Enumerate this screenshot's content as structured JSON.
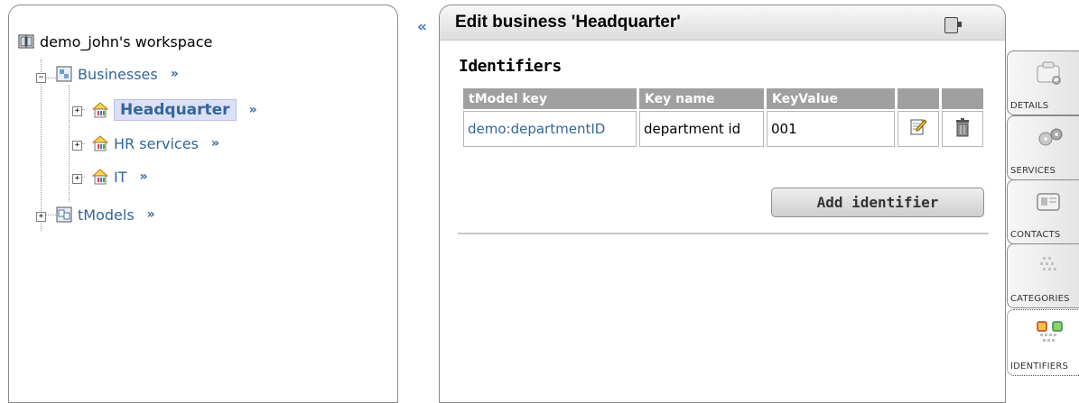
{
  "tree": {
    "workspace": "demo_john's workspace",
    "businesses": "Businesses",
    "children": [
      {
        "label": "Headquarter"
      },
      {
        "label": "HR services"
      },
      {
        "label": "IT"
      }
    ],
    "tmodels": "tModels",
    "chevron": "»"
  },
  "collapse_glyph": "«",
  "edit": {
    "title": "Edit business 'Headquarter'",
    "section": "Identifiers",
    "columns": [
      "tModel key",
      "Key name",
      "KeyValue",
      "",
      ""
    ],
    "rows": [
      {
        "tmodel_key": "demo:departmentID",
        "key_name": "department id",
        "key_value": "001"
      }
    ],
    "add_button": "Add identifier"
  },
  "side_tabs": [
    "DETAILS",
    "SERVICES",
    "CONTACTS",
    "CATEGORIES",
    "IDENTIFIERS"
  ],
  "colors": {
    "link": "#336699",
    "header_bg": "#a0a0a0",
    "selected_bg": "#dce0f5"
  }
}
